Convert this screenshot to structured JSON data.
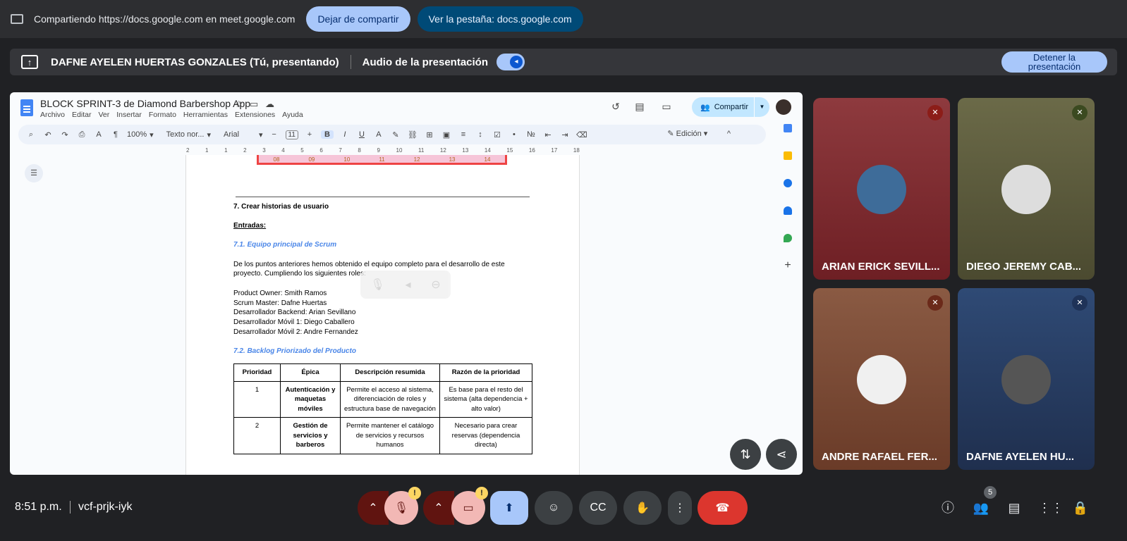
{
  "share_bar": {
    "sharing_text": "Compartiendo https://docs.google.com en meet.google.com",
    "stop_label": "Dejar de compartir",
    "view_tab_label": "Ver la pestaña: docs.google.com"
  },
  "presenting_bar": {
    "presenter": "DAFNE AYELEN HUERTAS GONZALES (Tú, presentando)",
    "audio_label": "Audio de la presentación",
    "audio_on": true,
    "stop_label": "Detener la presentación"
  },
  "docs": {
    "title": "BLOCK SPRINT-3 de Diamond Barbershop App",
    "menus": [
      "Archivo",
      "Editar",
      "Ver",
      "Insertar",
      "Formato",
      "Herramientas",
      "Extensiones",
      "Ayuda"
    ],
    "share_label": "Compartir",
    "toolbar": {
      "zoom": "100%",
      "style": "Texto nor...",
      "font": "Arial",
      "size": "11",
      "mode": "Edición"
    },
    "ruler": [
      "2",
      "1",
      "1",
      "2",
      "3",
      "4",
      "5",
      "6",
      "7",
      "8",
      "9",
      "10",
      "11",
      "12",
      "13",
      "14",
      "15",
      "16",
      "17",
      "18"
    ],
    "cal_numbers": [
      "08",
      "09",
      "10",
      "11",
      "12",
      "13",
      "14"
    ],
    "section_title": "7. Crear historias de usuario",
    "inputs_label": "Entradas:",
    "sub1": "7.1. Equipo principal de Scrum",
    "para1a": "De los puntos anteriores hemos obtenido el equipo completo para el desarrollo de este",
    "para1b": "proyecto. Cumpliendo los siguientes roles:",
    "roles": [
      "Product Owner: Smith Ramos",
      "Scrum Master: Dafne Huertas",
      "Desarrollador Backend: Arian Sevillano",
      "Desarrollador Móvil 1: Diego Caballero",
      "Desarrollador Móvil 2: Andre Fernandez"
    ],
    "sub2": "7.2. Backlog Priorizado del Producto",
    "table": {
      "headers": [
        "Prioridad",
        "Épica",
        "Descripción resumida",
        "Razón de la prioridad"
      ],
      "rows": [
        [
          "1",
          "Autenticación y maquetas móviles",
          "Permite el acceso al sistema, diferenciación de roles y estructura base de navegación",
          "Es base para el resto del sistema (alta dependencia + alto valor)"
        ],
        [
          "2",
          "Gestión de servicios y barberos",
          "Permite mantener el catálogo de servicios y recursos humanos",
          "Necesario para crear reservas (dependencia directa)"
        ]
      ]
    }
  },
  "participants": [
    {
      "name": "ARIAN ERICK SEVILL...",
      "bg": "#8b2a2e",
      "muted": true
    },
    {
      "name": "DIEGO JEREMY CAB...",
      "bg": "#5c5a3a",
      "muted": true
    },
    {
      "name": "ANDRE RAFAEL FER...",
      "bg": "#7a4a35",
      "muted": true
    },
    {
      "name": "DAFNE AYELEN HU...",
      "bg": "#2b3d5e",
      "muted": true
    }
  ],
  "bottom": {
    "time": "8:51 p.m.",
    "meeting_code": "vcf-prjk-iyk",
    "participant_count": "5",
    "warn_badge": "!"
  },
  "colors": {
    "accent": "#a8c7fa",
    "end_call": "#dc362e",
    "muted_red": "#8c1d18"
  }
}
